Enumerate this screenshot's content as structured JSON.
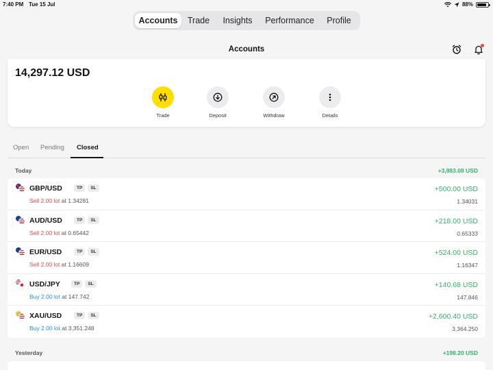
{
  "status_bar": {
    "time": "7:40 PM",
    "date": "Tue 15 Jul",
    "battery": "88%",
    "battery_level": 0.88
  },
  "top_nav": {
    "tabs": [
      {
        "label": "Accounts",
        "active": true
      },
      {
        "label": "Trade",
        "active": false
      },
      {
        "label": "Insights",
        "active": false
      },
      {
        "label": "Performance",
        "active": false
      },
      {
        "label": "Profile",
        "active": false
      }
    ]
  },
  "header": {
    "title": "Accounts",
    "icons": [
      "alarm-clock-icon",
      "bell-icon"
    ],
    "notification_dot_color": "#e5484d"
  },
  "account": {
    "balance": "14,297.12 USD",
    "actions": [
      {
        "label": "Trade",
        "icon": "candlestick-icon",
        "primary": true
      },
      {
        "label": "Deposit",
        "icon": "arrow-down-circle-icon",
        "primary": false
      },
      {
        "label": "Withdraw",
        "icon": "arrow-up-right-circle-icon",
        "primary": false
      },
      {
        "label": "Details",
        "icon": "more-vertical-icon",
        "primary": false
      }
    ]
  },
  "position_tabs": [
    {
      "label": "Open",
      "active": false
    },
    {
      "label": "Pending",
      "active": false
    },
    {
      "label": "Closed",
      "active": true
    }
  ],
  "colors": {
    "accent": "#ffde02",
    "profit": "#2fb36a",
    "sell": "#e5484d",
    "buy": "#2b8fe0"
  },
  "groups": [
    {
      "label": "Today",
      "total": "+3,983.08 USD",
      "trades": [
        {
          "symbol": "GBP/USD",
          "tp": "TP",
          "sl": "SL",
          "side": "Sell 2.00 lot",
          "side_type": "sell",
          "at": "at 1.34281",
          "pnl": "+500.00 USD",
          "close": "1.34031",
          "flags": [
            "gbp",
            "usd"
          ]
        },
        {
          "symbol": "AUD/USD",
          "tp": "TP",
          "sl": "SL",
          "side": "Sell 2.00 lot",
          "side_type": "sell",
          "at": "at 0.65442",
          "pnl": "+218.00 USD",
          "close": "0.65333",
          "flags": [
            "aud",
            "usd"
          ]
        },
        {
          "symbol": "EUR/USD",
          "tp": "TP",
          "sl": "SL",
          "side": "Sell 2.00 lot",
          "side_type": "sell",
          "at": "at 1.16609",
          "pnl": "+524.00 USD",
          "close": "1.16347",
          "flags": [
            "eur",
            "usd"
          ]
        },
        {
          "symbol": "USD/JPY",
          "tp": "TP",
          "sl": "SL",
          "side": "Buy 2.00 lot",
          "side_type": "buy",
          "at": "at 147.742",
          "pnl": "+140.68 USD",
          "close": "147.846",
          "flags": [
            "usd",
            "jpy"
          ]
        },
        {
          "symbol": "XAU/USD",
          "tp": "TP",
          "sl": "SL",
          "side": "Buy 2.00 lot",
          "side_type": "buy",
          "at": "at 3,351.248",
          "pnl": "+2,600.40 USD",
          "close": "3,364.250",
          "flags": [
            "xau",
            "usd"
          ]
        }
      ]
    },
    {
      "label": "Yesterday",
      "total": "+198.20 USD",
      "trades": []
    }
  ]
}
